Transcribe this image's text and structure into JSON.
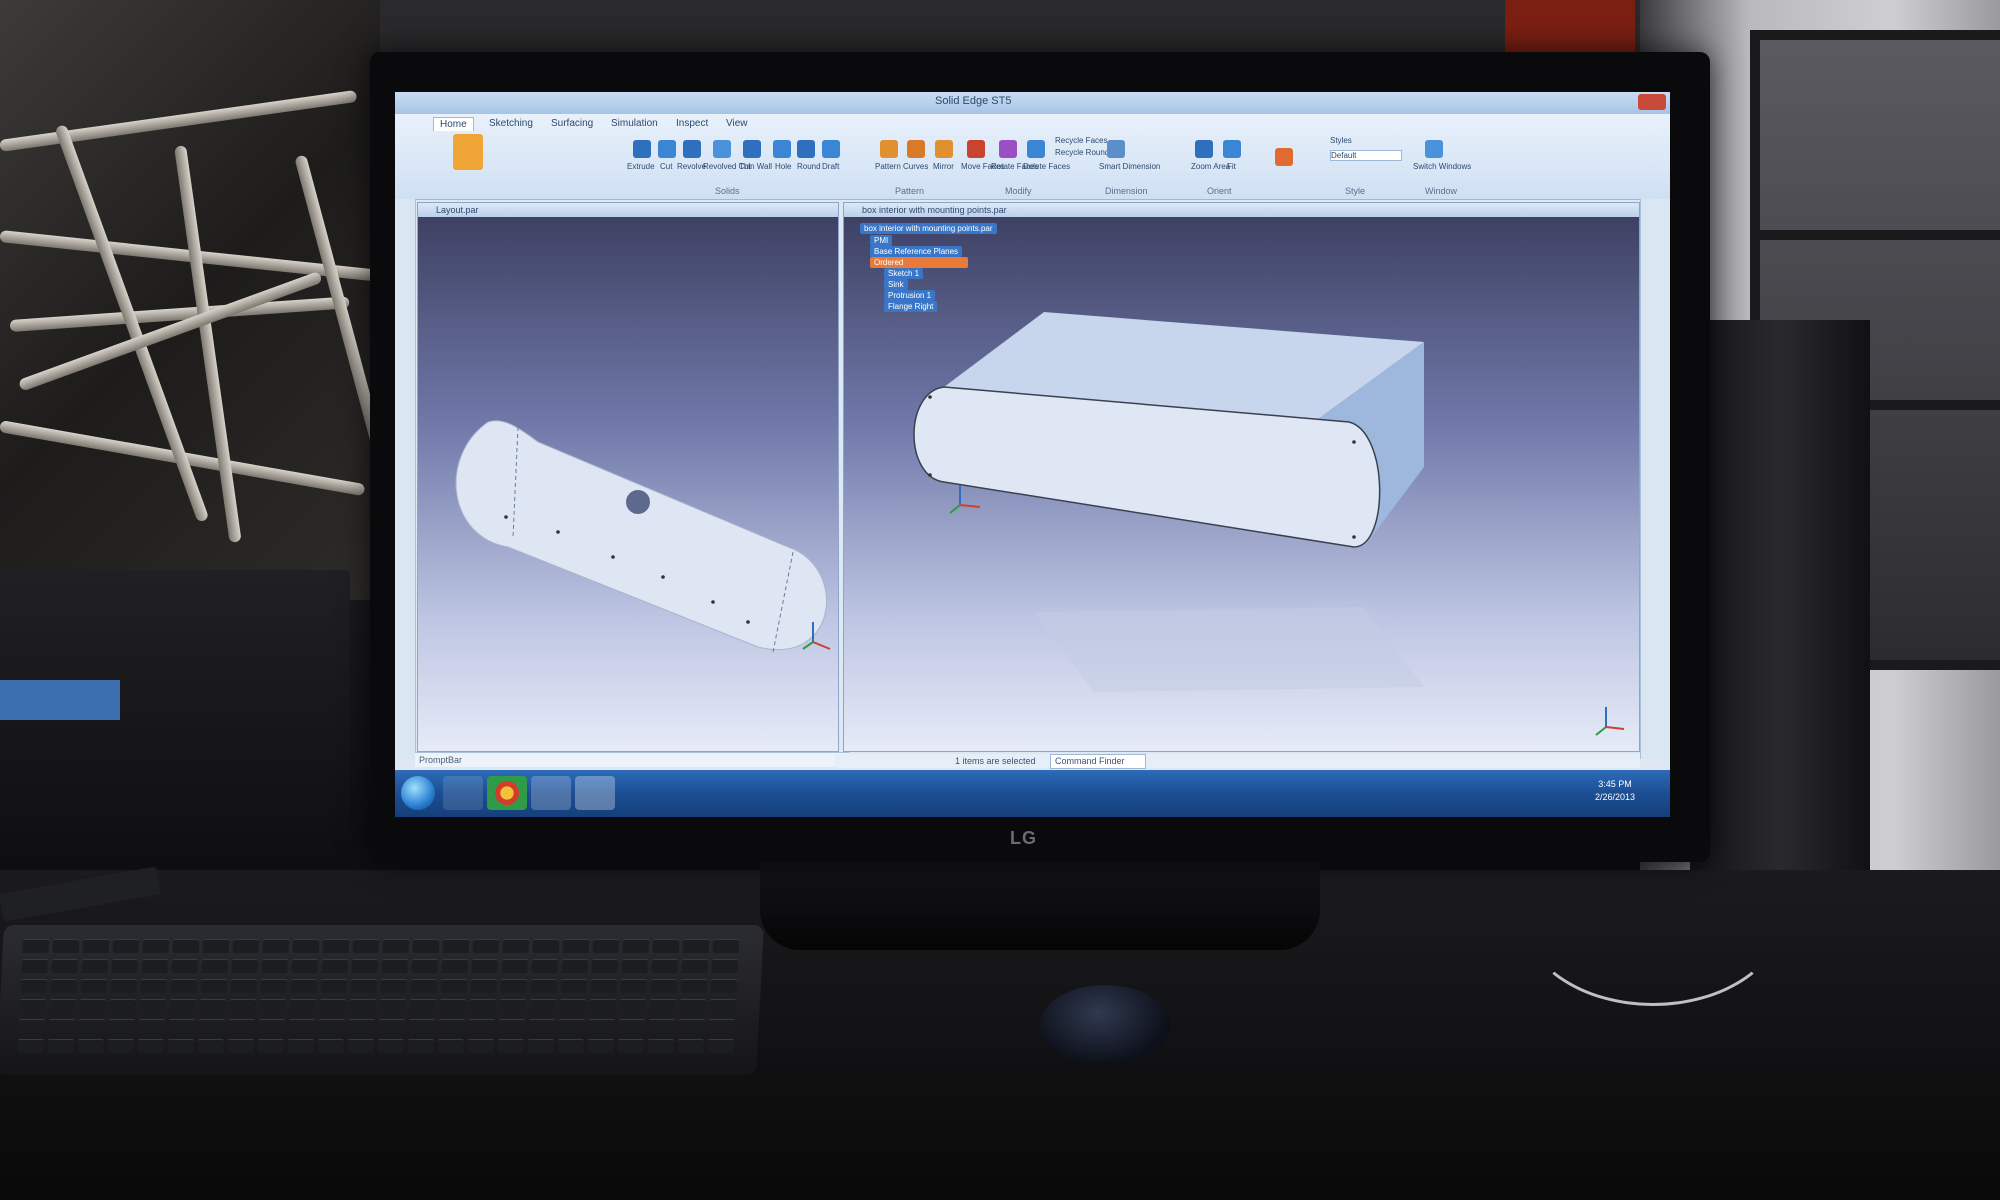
{
  "monitor": {
    "brand": "LG"
  },
  "app": {
    "title": "Solid Edge ST5",
    "tabs": [
      {
        "label": "Home",
        "active": true
      },
      {
        "label": "Sketching",
        "active": false
      },
      {
        "label": "Surfacing",
        "active": false
      },
      {
        "label": "Simulation",
        "active": false
      },
      {
        "label": "Inspect",
        "active": false
      },
      {
        "label": "View",
        "active": false
      }
    ],
    "ribbon_tools": {
      "extrude": "Extrude",
      "cut": "Cut",
      "revolve": "Revolve",
      "revolved_cut": "Revolved Cut",
      "thin_wall": "Thin Wall",
      "hole": "Hole",
      "round": "Round",
      "draft": "Draft",
      "pattern": "Pattern",
      "curves": "Curves",
      "mirror": "Mirror",
      "move_faces": "Move Faces",
      "rotate_faces": "Rotate Faces",
      "delete_faces": "Delete Faces",
      "recycle_faces": "Recycle Faces",
      "recycle_rounds": "Recycle Rounds",
      "smart_dimension": "Smart Dimension",
      "zoom_area": "Zoom Area",
      "fit": "Fit",
      "styles": "Styles",
      "style_default": "Default",
      "switch_windows": "Switch Windows"
    },
    "groups": [
      "Solids",
      "Pattern",
      "Modify",
      "Dimension",
      "Orient",
      "Style",
      "Window"
    ],
    "accent": "#2d6cb9"
  },
  "viewports": {
    "left_title": "Layout.par",
    "right_title": "box interior with mounting points.par"
  },
  "pathfinder": {
    "items": [
      "box interior with mounting points.par",
      "PMI",
      "Base Reference Planes",
      "Ordered",
      "Sketch 1",
      "Sink",
      "Protrusion 1",
      "Flange Right"
    ],
    "highlight_color": "#e87a3a"
  },
  "status": {
    "prompt": "PromptBar",
    "selected": "1 items are selected",
    "command_finder": "Command Finder"
  },
  "taskbar": {
    "time": "3:45 PM",
    "date": "2/26/2013"
  }
}
